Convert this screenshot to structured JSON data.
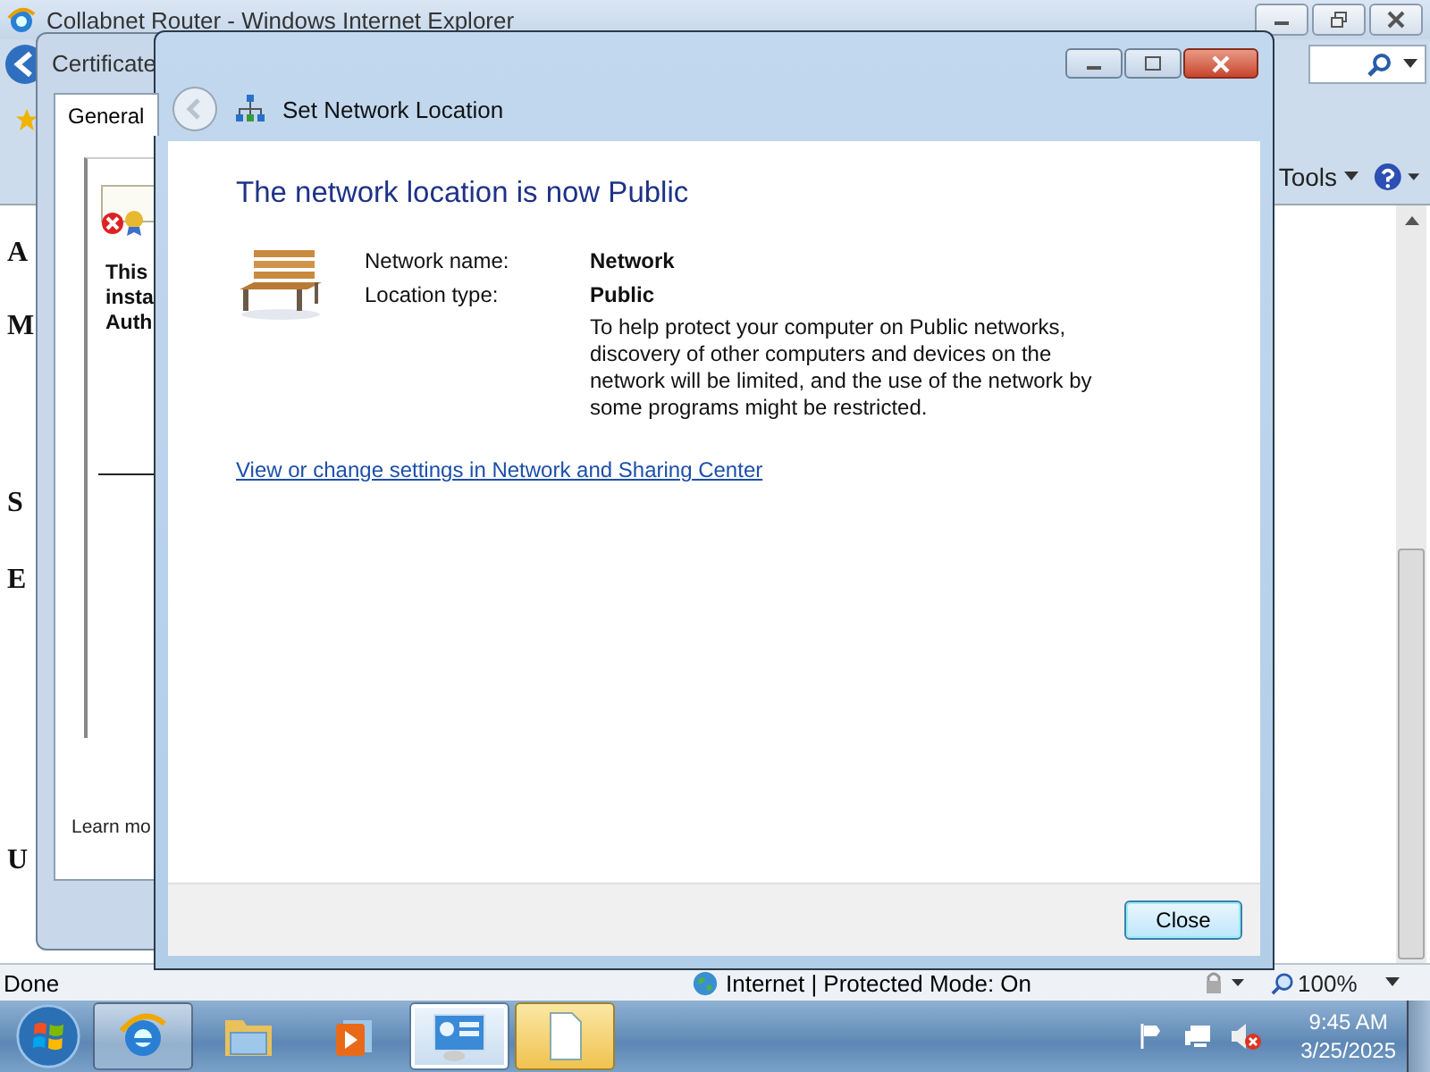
{
  "browser": {
    "title": "Collabnet Router - Windows Internet Explorer",
    "tools_label": "Tools",
    "page_letters": [
      "A",
      "M",
      "S",
      "E",
      "U"
    ],
    "status_text": "Done",
    "zone": "Internet | Protected Mode: On",
    "zoom": "100%"
  },
  "certificate_window": {
    "title": "Certificate",
    "tabs": [
      {
        "label": "General",
        "selected": true
      }
    ],
    "message_lines": [
      "This",
      "insta",
      "Auth"
    ],
    "link": "Learn mo"
  },
  "dialog": {
    "title": "Set Network Location",
    "heading": "The network location is now Public",
    "fields": [
      {
        "label": "Network name:",
        "value": "Network"
      },
      {
        "label": "Location type:",
        "value": "Public"
      }
    ],
    "description": "To help protect your computer on Public networks, discovery of other computers and devices on the network will be limited, and the use of the network by some programs might be restricted.",
    "link": "View or change settings in Network and Sharing Center",
    "buttons": [
      {
        "label": "Close"
      }
    ]
  },
  "taskbar": {
    "items": [
      {
        "kind": "browser",
        "running": true,
        "selected": false,
        "flashing": false
      },
      {
        "kind": "folder",
        "running": false,
        "selected": false,
        "flashing": false
      },
      {
        "kind": "media",
        "running": false,
        "selected": false,
        "flashing": false
      },
      {
        "kind": "network",
        "running": true,
        "selected": true,
        "flashing": false
      },
      {
        "kind": "document",
        "running": true,
        "selected": false,
        "flashing": true
      }
    ],
    "time": "9:45 AM",
    "date": "3/25/2025"
  }
}
